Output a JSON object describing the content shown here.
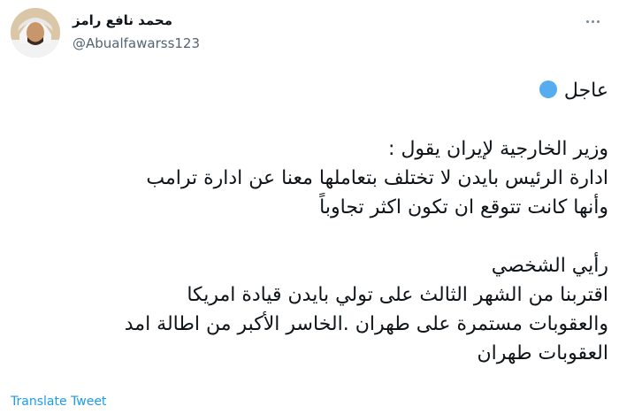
{
  "author": {
    "name": "محمد نافع رامز",
    "handle": "@Abualfawarss123"
  },
  "icons": {
    "avatar": "profile-photo",
    "more": "more-options-icon",
    "badge": "blue-circle-emoji"
  },
  "tweet": {
    "line1": "عاجل",
    "line2": "وزير الخارجية لإيران يقول :",
    "line3": "ادارة الرئيس بايدن لا تختلف بتعاملها معنا عن ادارة ترامب",
    "line4": "وأنها كانت تتوقع ان تكون اكثر تجاوباً",
    "line5": "رأيي الشخصي",
    "line6": "اقتربنا من الشهر الثالث على تولي بايدن قيادة امريكا",
    "line7": "والعقوبات مستمرة على طهران .الخاسر الأكبر من اطالة امد",
    "line8": "العقوبات طهران"
  },
  "footer": {
    "translate_label": "Translate Tweet"
  },
  "colors": {
    "link": "#1d9bf0",
    "secondary_text": "#536471",
    "badge": "#55acee"
  }
}
